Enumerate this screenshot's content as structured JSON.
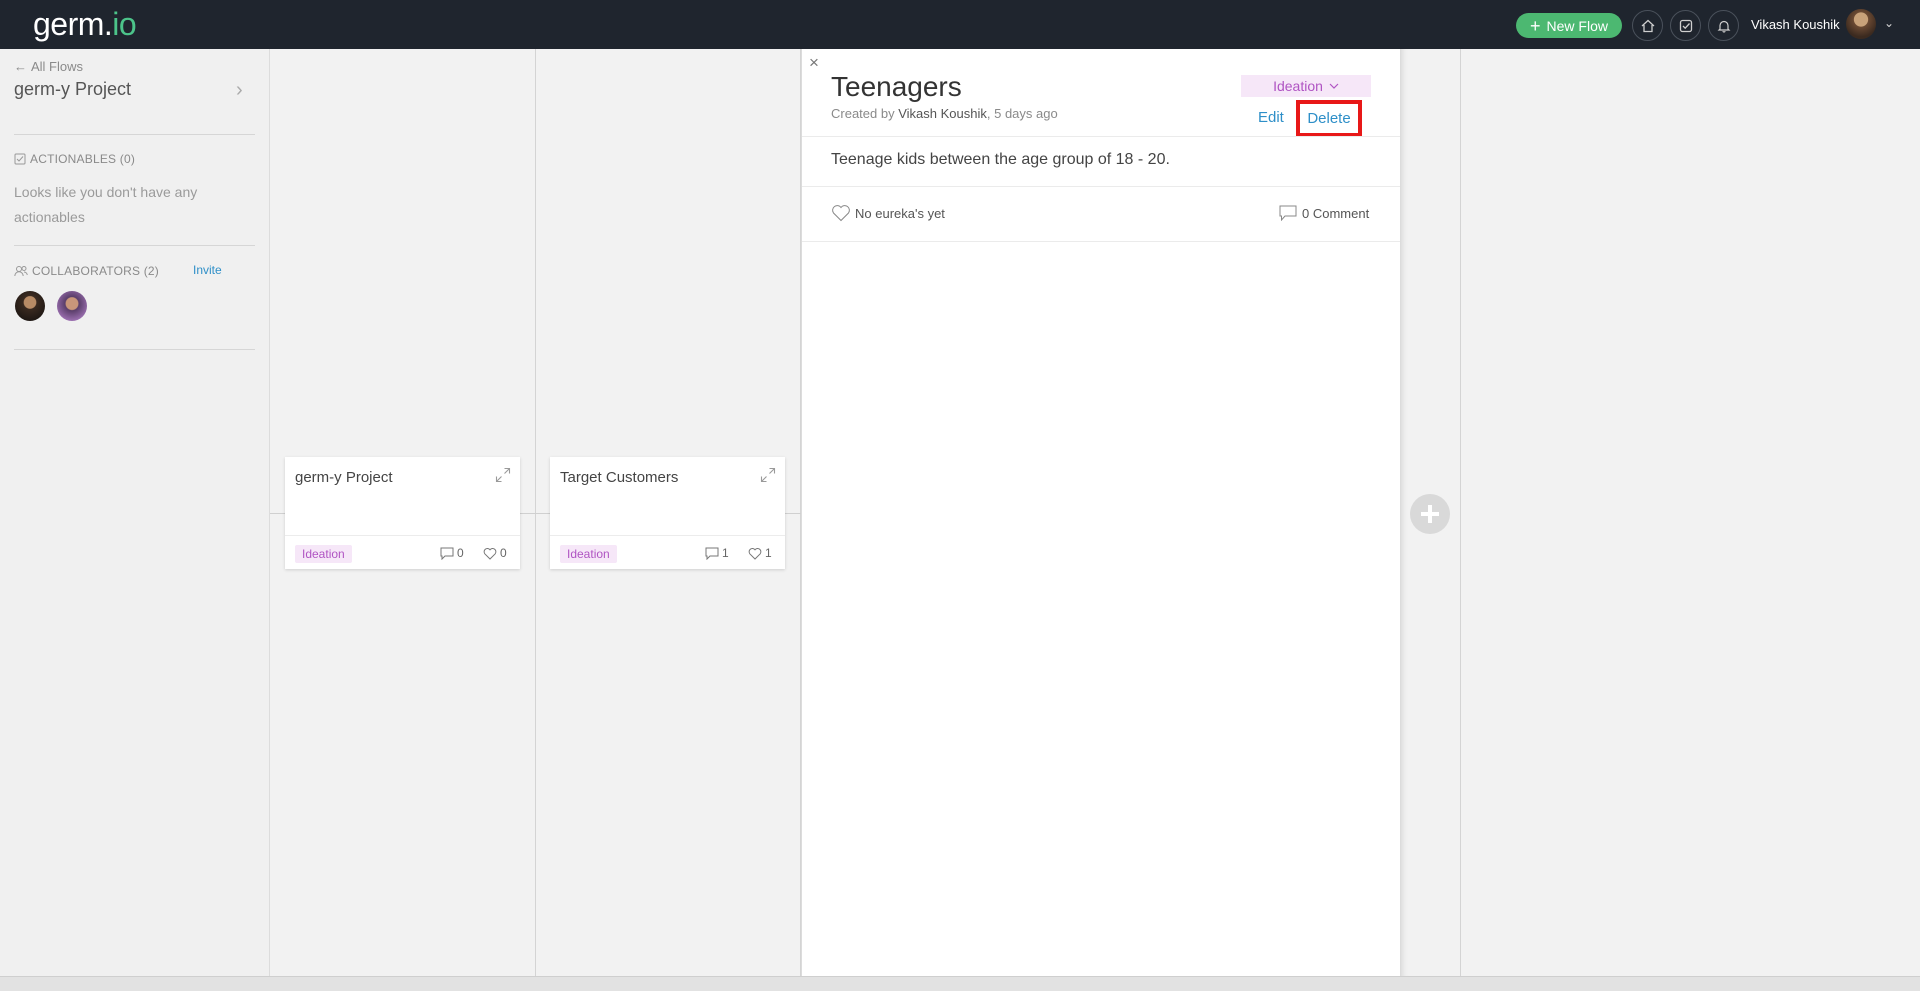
{
  "topbar": {
    "logo_main": "germ",
    "logo_dot": ".",
    "logo_io": "io",
    "new_flow_label": "New Flow",
    "user_name": "Vikash Koushik",
    "icons": [
      "home-icon",
      "check-square-icon",
      "bell-icon"
    ]
  },
  "sidebar": {
    "back_label": "All Flows",
    "project_title": "germ-y Project",
    "actionables_label": "ACTIONABLES (0)",
    "actionables_empty": "Looks like you don't have any actionables",
    "collaborators_label": "COLLABORATORS (2)",
    "invite_label": "Invite"
  },
  "cards": [
    {
      "title": "germ-y Project",
      "tag": "Ideation",
      "comments": "0",
      "likes": "0"
    },
    {
      "title": "Target Customers",
      "tag": "Ideation",
      "comments": "1",
      "likes": "1"
    }
  ],
  "detail": {
    "close": "×",
    "title": "Teenagers",
    "created_prefix": "Created by",
    "author": "Vikash Koushik",
    "created_suffix": ", 5 days ago",
    "status": "Ideation",
    "edit_label": "Edit",
    "delete_label": "Delete",
    "description": "Teenage kids between the age group of 18 - 20.",
    "eureka_text": "No eureka's yet",
    "comment_text": "0 Comment"
  },
  "colors": {
    "topbar_bg": "#1f252e",
    "new_flow_green": "#4cb871",
    "tag_bg": "#f6e7f8",
    "tag_text": "#b054c3",
    "link_blue": "#2e8fc8",
    "highlight_red": "#e81818"
  }
}
